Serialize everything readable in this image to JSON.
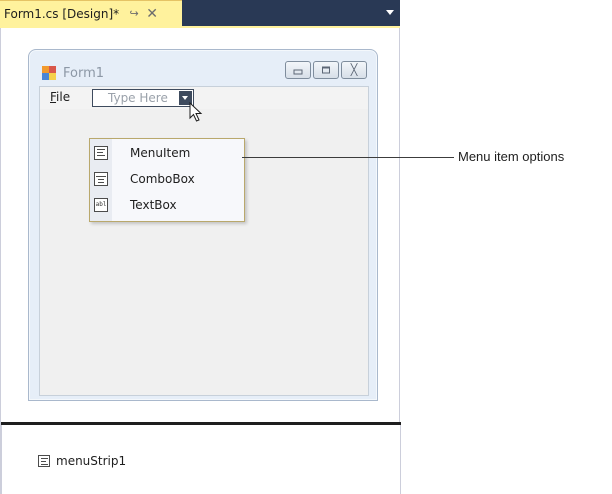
{
  "tab": {
    "title": "Form1.cs [Design]*",
    "pin_icon": "pin-icon",
    "close_icon": "close-icon",
    "active_color": "#fff29d",
    "strip_color": "#293955"
  },
  "form": {
    "title": "Form1",
    "icon": "form-icon",
    "caption_buttons": [
      "minimize",
      "maximize",
      "close"
    ]
  },
  "menu_strip": {
    "file_label_mnemonic": "F",
    "file_label_rest": "ile",
    "type_here_placeholder": "Type Here"
  },
  "dropdown": {
    "items": [
      {
        "label": "MenuItem",
        "icon": "menu-item-icon"
      },
      {
        "label": "ComboBox",
        "icon": "combo-box-icon"
      },
      {
        "label": "TextBox",
        "icon": "text-box-icon"
      }
    ]
  },
  "callout": {
    "text": "Menu item options"
  },
  "tray": {
    "component_label": "menuStrip1",
    "component_icon": "menu-strip-icon"
  }
}
